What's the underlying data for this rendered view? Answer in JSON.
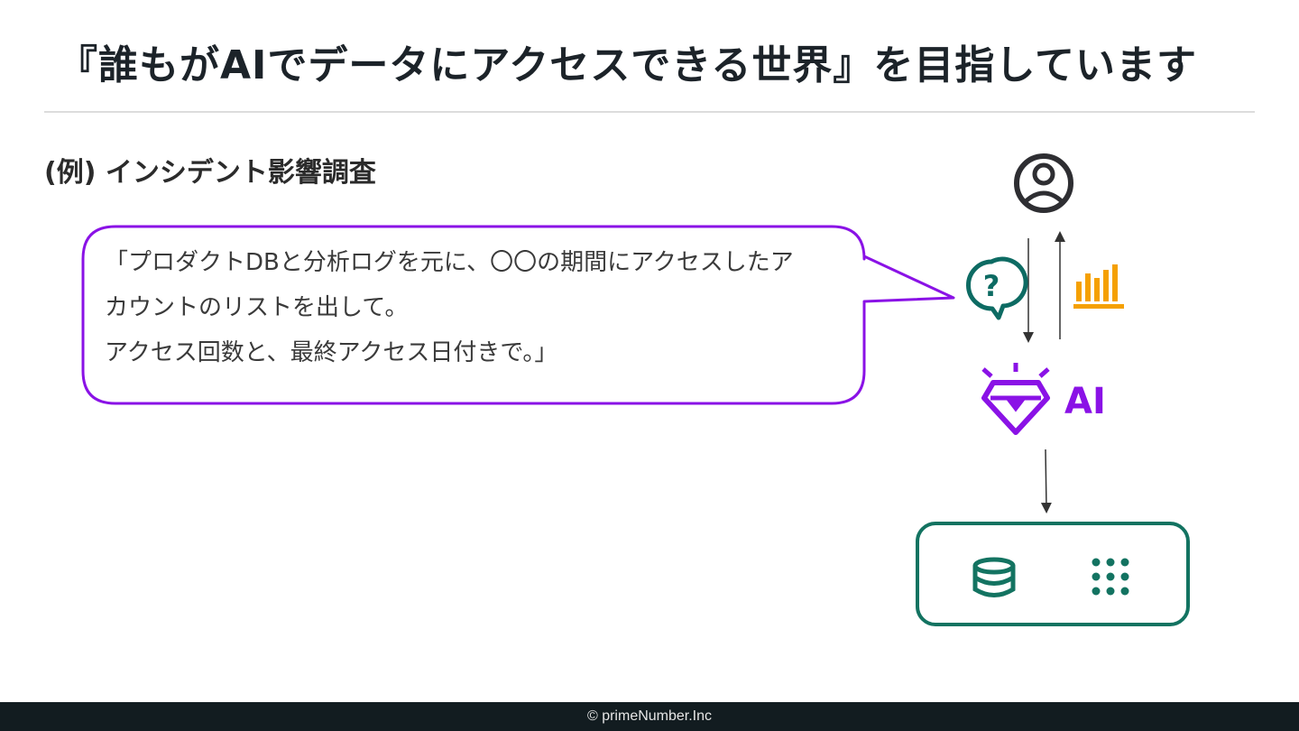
{
  "slide": {
    "title": "『誰もがAIでデータにアクセスできる世界』を目指しています",
    "subtitle": "(例) インシデント影響調査",
    "bubble_lines": [
      "「プロダクトDBと分析ログを元に、〇〇の期間にアクセスしたア",
      "カウントのリストを出して。",
      "アクセス回数と、最終アクセス日付きで。」"
    ],
    "ai_label": "AI",
    "footer": "© primeNumber.Inc"
  },
  "colors": {
    "title": "#1c2329",
    "bubble_border": "#8a12e6",
    "ai_purple": "#8a12e6",
    "teal": "#137361",
    "question_teal": "#0d6b63",
    "chart_orange": "#f5a000",
    "user_icon": "#2e2e32",
    "footer_bg": "#121c20"
  },
  "icons": {
    "user": "user-circle-icon",
    "question": "question-bubble-icon",
    "chart": "bar-chart-icon",
    "ai": "diamond-gem-icon",
    "database": "database-icon",
    "grid": "dot-grid-icon"
  }
}
